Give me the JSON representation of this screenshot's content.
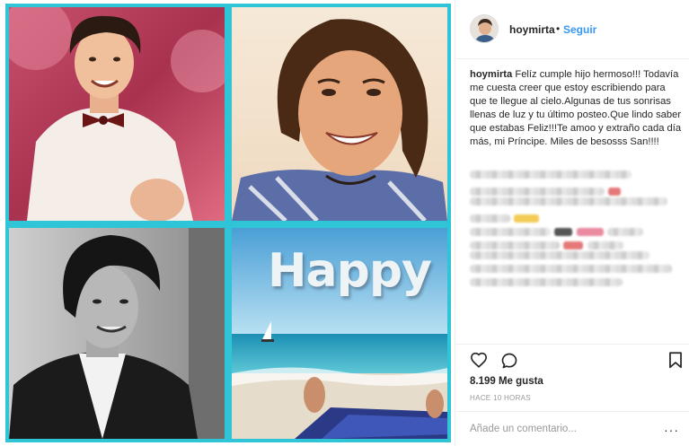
{
  "post": {
    "username": "hoymirta",
    "separator": "•",
    "follow_label": "Seguir",
    "image": {
      "tiles": [
        {
          "name": "tile-portrait-bowtie",
          "style": "warm pink party photo"
        },
        {
          "name": "tile-portrait-smiling",
          "style": "close-up smiling portrait"
        },
        {
          "name": "tile-portrait-suit",
          "style": "black and white portrait"
        },
        {
          "name": "tile-beach",
          "text": "Happy"
        }
      ]
    },
    "caption": {
      "username": "hoymirta",
      "text": "Felíz cumple hijo hermoso!!! Todavía me cuesta creer que estoy escribiendo para que te llegue al cielo.Algunas de tus sonrisas llenas de luz y tu último posteo.Que lindo saber que estabas Feliz!!!Te amoo y extraño cada día más, mi Príncipe. Miles de besosss San!!!!"
    },
    "likes": "8.199 Me gusta",
    "timestamp": "HACE 10 HORAS",
    "comment_placeholder": "Añade un comentario...",
    "more_label": "···"
  },
  "icons": {
    "like": "heart-icon",
    "comment": "comment-icon",
    "save": "bookmark-icon"
  },
  "colors": {
    "accent": "#3897f0",
    "frame": "#2fc4d6",
    "text": "#262626",
    "muted": "#999999"
  }
}
